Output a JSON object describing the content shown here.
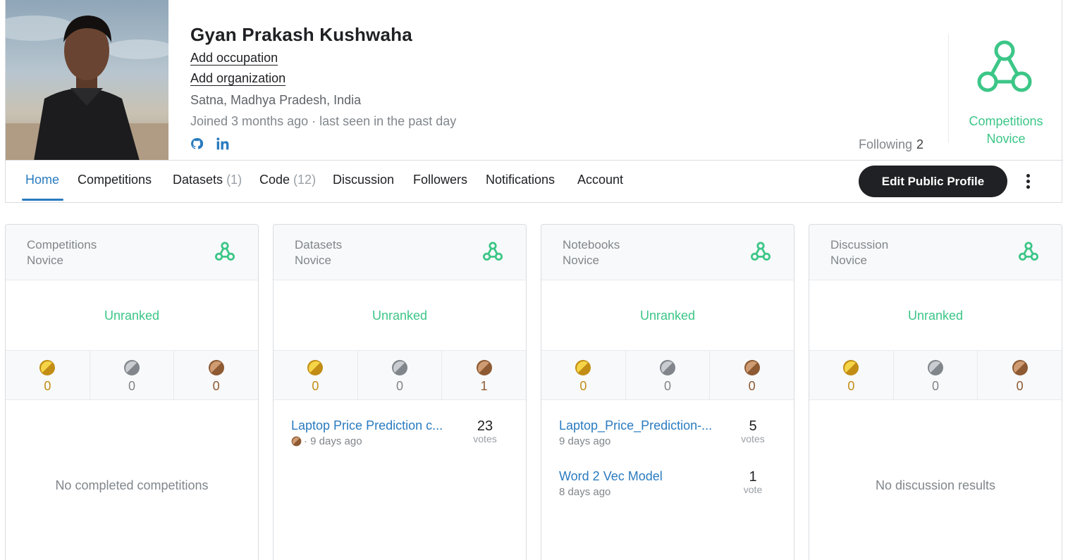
{
  "profile": {
    "name": "Gyan Prakash Kushwaha",
    "add_occupation": "Add occupation",
    "add_organization": "Add organization",
    "location": "Satna, Madhya Pradesh, India",
    "joined": "Joined 3 months ago · last seen in the past day",
    "social_icons": [
      "github-icon",
      "linkedin-icon"
    ],
    "following_label": "Following",
    "following_count": "2",
    "tier_line1": "Competitions",
    "tier_line2": "Novice",
    "tier_color": "#3cc687"
  },
  "tabs": [
    {
      "label": "Home",
      "count": ""
    },
    {
      "label": "Competitions",
      "count": ""
    },
    {
      "label": "Datasets",
      "count": "(1)"
    },
    {
      "label": "Code",
      "count": "(12)"
    },
    {
      "label": "Discussion",
      "count": ""
    },
    {
      "label": "Followers",
      "count": ""
    },
    {
      "label": "Notifications",
      "count": ""
    },
    {
      "label": "Account",
      "count": ""
    }
  ],
  "active_tab": "Home",
  "edit_button": "Edit Public Profile",
  "cards": [
    {
      "title1": "Competitions",
      "title2": "Novice",
      "rank": "Unranked",
      "gold": "0",
      "silver": "0",
      "bronze": "0",
      "empty": "No completed competitions"
    },
    {
      "title1": "Datasets",
      "title2": "Novice",
      "rank": "Unranked",
      "gold": "0",
      "silver": "0",
      "bronze": "1",
      "items": [
        {
          "title": "Laptop Price Prediction c...",
          "sub": "· 9 days ago",
          "votes": "23",
          "votes_label": "votes",
          "medal": "bronze"
        }
      ]
    },
    {
      "title1": "Notebooks",
      "title2": "Novice",
      "rank": "Unranked",
      "gold": "0",
      "silver": "0",
      "bronze": "0",
      "items": [
        {
          "title": "Laptop_Price_Prediction-...",
          "sub": "9 days ago",
          "votes": "5",
          "votes_label": "votes"
        },
        {
          "title": "Word 2 Vec Model",
          "sub": "8 days ago",
          "votes": "1",
          "votes_label": "vote"
        }
      ]
    },
    {
      "title1": "Discussion",
      "title2": "Novice",
      "rank": "Unranked",
      "gold": "0",
      "silver": "0",
      "bronze": "0",
      "empty": "No discussion results"
    }
  ],
  "colors": {
    "gold": "#c28d15",
    "silver": "#80868b",
    "bronze": "#8d5a33",
    "link": "#2a7bbf",
    "novice": "#3cc687"
  }
}
